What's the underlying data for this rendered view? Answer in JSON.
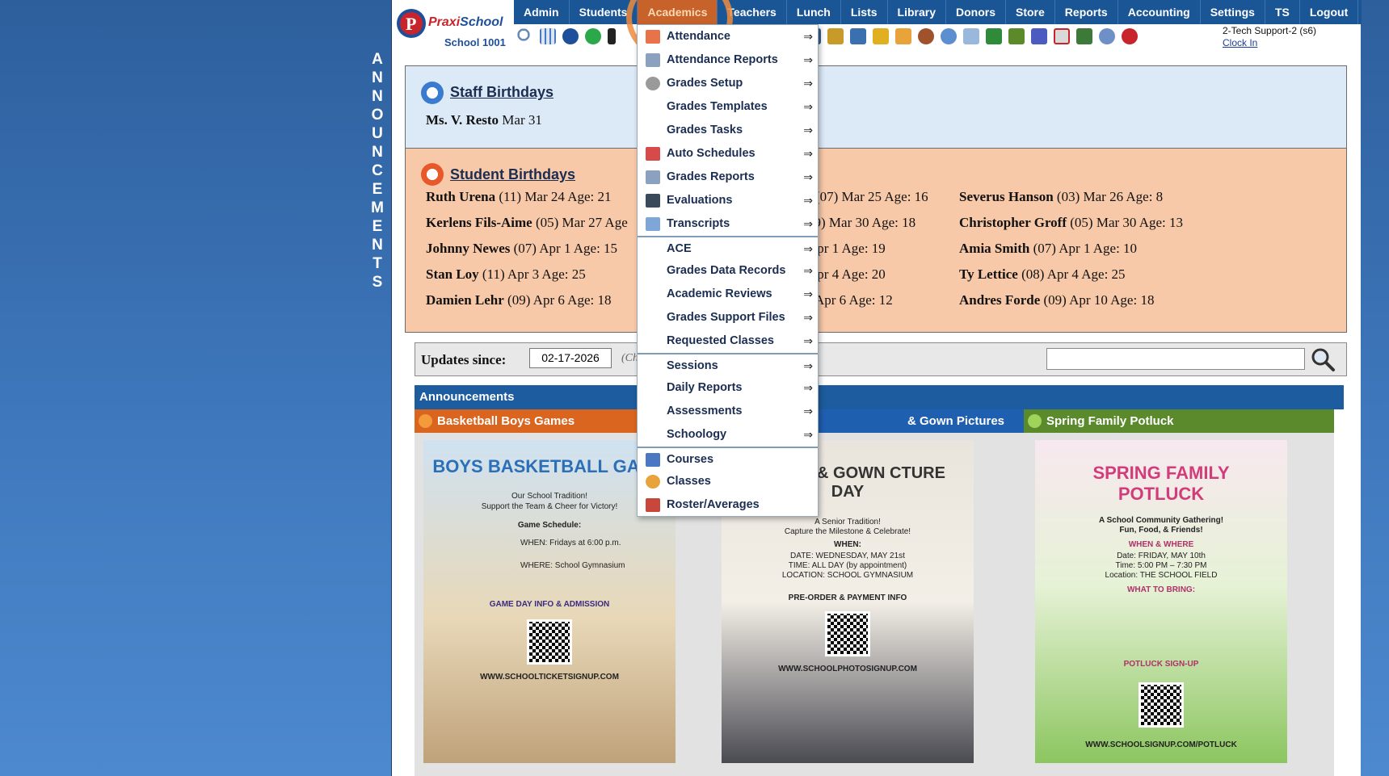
{
  "sidebar": {
    "letters": [
      "A",
      "N",
      "N",
      "O",
      "U",
      "N",
      "C",
      "E",
      "M",
      "E",
      "N",
      "T",
      "S"
    ]
  },
  "logo": {
    "brand_part1": "Praxi",
    "brand_part2": "School",
    "school_name": "School 1001"
  },
  "nav": {
    "items": [
      "Admin",
      "Students",
      "Academics",
      "Teachers",
      "Lunch",
      "Lists",
      "Library",
      "Donors",
      "Store",
      "Reports",
      "Accounting",
      "Settings",
      "TS",
      "Logout"
    ],
    "active": "Academics"
  },
  "user": {
    "name": "2-Tech Support-2 (s6)",
    "clock_link": "Clock In"
  },
  "staff_birthdays": {
    "title": "Staff Birthdays",
    "entries": [
      {
        "name": "Ms. V. Resto",
        "detail": "Mar 31"
      }
    ]
  },
  "student_birthdays": {
    "title": "Student Birthdays",
    "col1": [
      {
        "name": "Ruth Urena",
        "detail": "(11) Mar 24 Age: 21"
      },
      {
        "name": "Kerlens Fils-Aime",
        "detail": "(05) Mar 27 Age"
      },
      {
        "name": "Johnny Newes",
        "detail": "(07) Apr 1 Age: 15"
      },
      {
        "name": "Stan Loy",
        "detail": "(11) Apr 3 Age: 25"
      },
      {
        "name": "Damien Lehr",
        "detail": "(09) Apr 6 Age: 18"
      }
    ],
    "col2": [
      {
        "name": "",
        "detail": "r (07) Mar 25 Age: 16"
      },
      {
        "name": "",
        "detail": "09) Mar 30 Age: 18"
      },
      {
        "name": "",
        "detail": "Apr 1 Age: 19"
      },
      {
        "name": "",
        "detail": "Apr 4 Age: 20"
      },
      {
        "name": "",
        "detail": ") Apr 6 Age: 12"
      }
    ],
    "col3": [
      {
        "name": "Severus Hanson",
        "detail": "(03) Mar 26 Age: 8"
      },
      {
        "name": "Christopher Groff",
        "detail": "(05) Mar 30 Age: 13"
      },
      {
        "name": "Amia Smith",
        "detail": "(07) Apr 1 Age: 10"
      },
      {
        "name": "Ty Lettice",
        "detail": "(08) Apr 4 Age: 25"
      },
      {
        "name": "Andres Forde",
        "detail": "(09) Apr 10 Age: 18"
      }
    ]
  },
  "updates": {
    "label": "Updates since:",
    "date": "02-17-2026",
    "hint": "(Ch"
  },
  "search": {
    "placeholder": ""
  },
  "announcements": {
    "header": "Announcements",
    "cards": [
      {
        "title": "Basketball Boys Games",
        "color": "#d9651f",
        "poster": {
          "headline": "BOYS BASKETBALL GAME",
          "lines": [
            "Our School Tradition!",
            "Support the Team & Cheer for Victory!",
            "Game Schedule:",
            "WHEN: Fridays at 6:00 p.m.",
            "WHERE: School Gymnasium",
            "GAME DAY INFO & ADMISSION",
            "WWW.SCHOOLTICKETSIGNUP.COM"
          ]
        }
      },
      {
        "title": "& Gown Pictures",
        "color": "#1f5fb0",
        "poster": {
          "headline": "OR CAP & GOWN CTURE DAY",
          "lines": [
            "A Senior Tradition!",
            "Capture the Milestone & Celebrate!",
            "WHEN:",
            "DATE: WEDNESDAY, MAY 21st",
            "TIME: ALL DAY (by appointment)",
            "LOCATION: SCHOOL GYMNASIUM",
            "PRE-ORDER & PAYMENT INFO",
            "WWW.SCHOOLPHOTOSIGNUP.COM"
          ]
        }
      },
      {
        "title": "Spring Family Potluck",
        "color": "#5a8a2c",
        "poster": {
          "headline": "SPRING FAMILY POTLUCK",
          "lines": [
            "A School Community Gathering!",
            "Fun, Food, & Friends!",
            "WHEN & WHERE",
            "Date: FRIDAY, MAY 10th",
            "Time: 5:00 PM – 7:30 PM",
            "Location: THE SCHOOL FIELD",
            "WHAT TO BRING:",
            "POTLUCK SIGN-UP",
            "WWW.SCHOOLSIGNUP.COM/POTLUCK"
          ]
        }
      }
    ]
  },
  "academics_menu": {
    "items": [
      {
        "label": "Attendance",
        "icon": "calendar-icon",
        "arrow": true
      },
      {
        "label": "Attendance Reports",
        "icon": "printer-icon",
        "arrow": true
      },
      {
        "label": "Grades Setup",
        "icon": "gear-icon",
        "arrow": true
      },
      {
        "label": "Grades Templates",
        "icon": "",
        "arrow": true
      },
      {
        "label": "Grades Tasks",
        "icon": "",
        "arrow": true
      },
      {
        "label": "Auto Schedules",
        "icon": "calendar-clock-icon",
        "arrow": true
      },
      {
        "label": "Grades Reports",
        "icon": "printer-icon",
        "arrow": true
      },
      {
        "label": "Evaluations",
        "icon": "checkbox-icon",
        "arrow": true
      },
      {
        "label": "Transcripts",
        "icon": "document-icon",
        "arrow": true
      },
      {
        "label": "ACE",
        "icon": "",
        "arrow": true,
        "separator": true
      },
      {
        "label": "Grades Data Records",
        "icon": "",
        "arrow": true
      },
      {
        "label": "Academic Reviews",
        "icon": "",
        "arrow": true
      },
      {
        "label": "Grades Support Files",
        "icon": "",
        "arrow": true
      },
      {
        "label": "Requested Classes",
        "icon": "",
        "arrow": true
      },
      {
        "label": "Sessions",
        "icon": "",
        "arrow": true,
        "separator": true
      },
      {
        "label": "Daily Reports",
        "icon": "",
        "arrow": true
      },
      {
        "label": "Assessments",
        "icon": "",
        "arrow": true
      },
      {
        "label": "Schoology",
        "icon": "",
        "arrow": true
      },
      {
        "label": "Courses",
        "icon": "book-icon",
        "arrow": false,
        "separator": true
      },
      {
        "label": "Classes",
        "icon": "person-icon",
        "arrow": false
      },
      {
        "label": "Roster/Averages",
        "icon": "roster-icon",
        "arrow": false
      }
    ],
    "arrow_glyph": "⇒"
  }
}
